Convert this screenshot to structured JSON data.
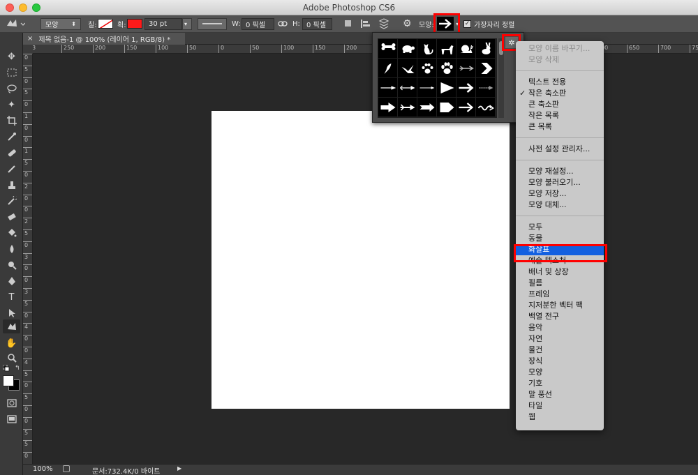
{
  "window": {
    "title": "Adobe Photoshop CS6"
  },
  "options_bar": {
    "mode_dropdown": "모양",
    "fill_label": "칠:",
    "stroke_label": "획:",
    "stroke_color": "#ff1a1a",
    "stroke_width": "30 pt",
    "w_label": "W:",
    "w_value": "0 픽셀",
    "h_label": "H:",
    "h_value": "0 픽셀",
    "shape_label": "모양:",
    "align_edges_label": "가장자리 정렬",
    "align_edges_checked": true
  },
  "document": {
    "tab_title": "제목 없음-1 @ 100% (레이어 1, RGB/8) *",
    "zoom": "100%",
    "doc_info": "문서:732.4K/0 바이트"
  },
  "rulers": {
    "h": [
      "3",
      "250",
      "200",
      "150",
      "100",
      "50",
      "0",
      "50",
      "100",
      "150",
      "200",
      "250",
      "300",
      "350",
      "400",
      "450",
      "500",
      "550",
      "600",
      "650",
      "700",
      "750"
    ],
    "v": [
      "0",
      "5",
      "0",
      "5",
      "0",
      "1",
      "0",
      "0",
      "1",
      "5",
      "0",
      "2",
      "0",
      "0",
      "2",
      "5",
      "0",
      "3",
      "0",
      "0",
      "3",
      "5",
      "0",
      "4",
      "0",
      "0",
      "4",
      "5",
      "0",
      "5",
      "0",
      "0",
      "5",
      "5",
      "0"
    ]
  },
  "picker": {
    "shapes": [
      "bone",
      "turtle",
      "cat",
      "dog",
      "snail",
      "rabbit",
      "bird",
      "dove",
      "paw-print",
      "paw-print-2",
      "arrow-feather",
      "chevron",
      "arrow-thin",
      "arrow-thin-2",
      "arrow-line",
      "arrow-triangle",
      "arrow-bold",
      "arrow-dotted",
      "arrow-block",
      "arrow-fletched",
      "arrow-fletched-2",
      "arrow-pentagon",
      "arrow-right",
      "arrow-wavy"
    ]
  },
  "menu": {
    "items": [
      {
        "label": "모양 이름 바꾸기...",
        "disabled": true
      },
      {
        "label": "모양 삭제",
        "disabled": true
      },
      {
        "sep": true
      },
      {
        "label": "텍스트 전용"
      },
      {
        "label": "작은 축소판",
        "checked": true
      },
      {
        "label": "큰 축소판"
      },
      {
        "label": "작은 목록"
      },
      {
        "label": "큰 목록"
      },
      {
        "sep": true
      },
      {
        "label": "사전 설정 관리자..."
      },
      {
        "sep": true
      },
      {
        "label": "모양 재설정..."
      },
      {
        "label": "모양 불러오기..."
      },
      {
        "label": "모양 저장..."
      },
      {
        "label": "모양 대체..."
      },
      {
        "sep": true
      },
      {
        "label": "모두"
      },
      {
        "label": "동물"
      },
      {
        "label": "화살표",
        "selected": true
      },
      {
        "label": "예술 텍스처"
      },
      {
        "label": "배너 및 상장"
      },
      {
        "label": "필름"
      },
      {
        "label": "프레임"
      },
      {
        "label": "지저분한 벡터 팩"
      },
      {
        "label": "백열 전구"
      },
      {
        "label": "음악"
      },
      {
        "label": "자연"
      },
      {
        "label": "물건"
      },
      {
        "label": "장식"
      },
      {
        "label": "모양"
      },
      {
        "label": "기호"
      },
      {
        "label": "말 풍선"
      },
      {
        "label": "타일"
      },
      {
        "label": "웹"
      }
    ]
  }
}
